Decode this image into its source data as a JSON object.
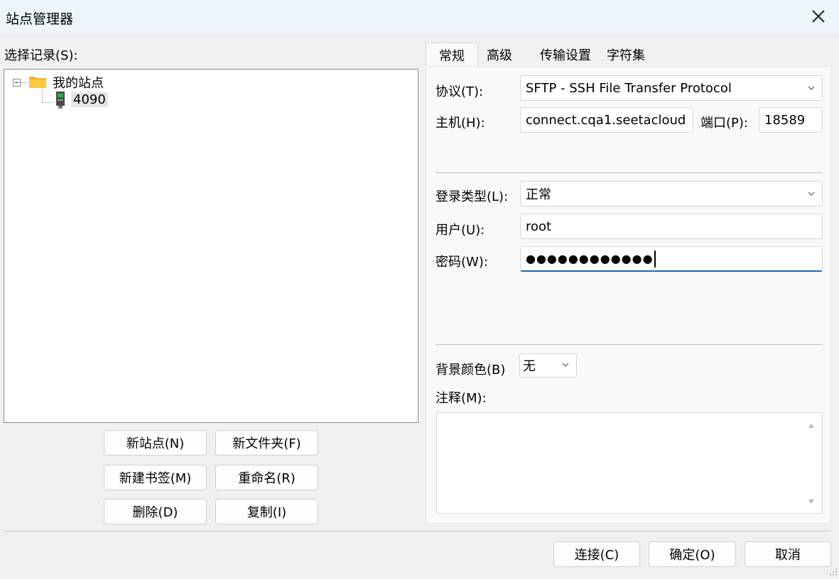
{
  "window": {
    "title": "站点管理器"
  },
  "left": {
    "select_label": "选择记录(S):",
    "tree": {
      "root_label": "我的站点",
      "child_label": "4090"
    },
    "buttons": {
      "new_site": "新站点(N)",
      "new_folder": "新文件夹(F)",
      "new_bookmark": "新建书签(M)",
      "rename": "重命名(R)",
      "delete": "删除(D)",
      "duplicate": "复制(I)"
    }
  },
  "tabs": [
    "常规",
    "高级",
    "传输设置",
    "字符集"
  ],
  "general": {
    "protocol_label": "协议(T):",
    "protocol_value": "SFTP - SSH File Transfer Protocol",
    "host_label": "主机(H):",
    "host_value": "connect.cqa1.seetacloud",
    "port_label": "端口(P):",
    "port_value": "18589",
    "logon_type_label": "登录类型(L):",
    "logon_type_value": "正常",
    "user_label": "用户(U):",
    "user_value": "root",
    "password_label": "密码(W):",
    "password_value": "●●●●●●●●●●●●",
    "bg_color_label": "背景颜色(B)",
    "bg_color_value": "无",
    "comments_label": "注释(M):",
    "comments_value": ""
  },
  "footer": {
    "connect": "连接(C)",
    "ok": "确定(O)",
    "cancel": "取消"
  },
  "icons": {
    "close": "close-icon",
    "folder": "folder-icon",
    "server": "server-icon",
    "dropdown": "chevron-down-icon"
  },
  "colors": {
    "folder": "#f6b61d",
    "focus_border": "#1d64b8",
    "titlebar_bg": "#eef5fa"
  }
}
